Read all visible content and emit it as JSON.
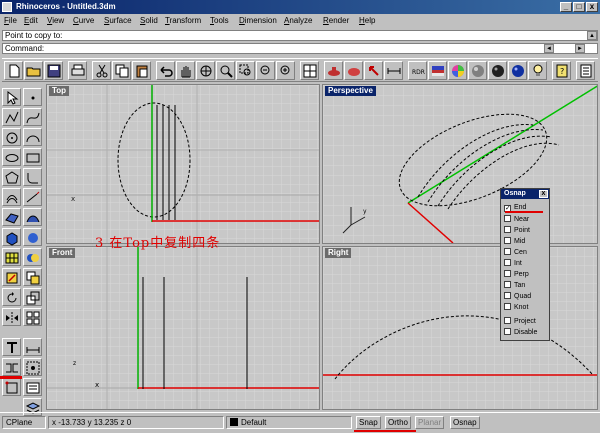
{
  "window": {
    "title": "Rhinoceros - Untitled.3dm",
    "minimize": "_",
    "maximize": "□",
    "close": "x"
  },
  "menu": [
    "File",
    "Edit",
    "View",
    "Curve",
    "Surface",
    "Solid",
    "Transform",
    "Tools",
    "Dimension",
    "Analyze",
    "Render",
    "Help"
  ],
  "history": "Point to copy to:",
  "command": {
    "label": "Command:",
    "value": ""
  },
  "viewports": {
    "top": {
      "label": "Top"
    },
    "perspective": {
      "label": "Perspective"
    },
    "front": {
      "label": "Front"
    },
    "right": {
      "label": "Right"
    }
  },
  "osnap": {
    "title": "Osnap",
    "close": "x",
    "options": [
      {
        "label": "End",
        "checked": true
      },
      {
        "label": "Near",
        "checked": false
      },
      {
        "label": "Point",
        "checked": false
      },
      {
        "label": "Mid",
        "checked": false
      },
      {
        "label": "Cen",
        "checked": false
      },
      {
        "label": "Int",
        "checked": false
      },
      {
        "label": "Perp",
        "checked": false
      },
      {
        "label": "Tan",
        "checked": false
      },
      {
        "label": "Quad",
        "checked": false
      },
      {
        "label": "Knot",
        "checked": false
      },
      {
        "label": "Project",
        "checked": false
      },
      {
        "label": "Disable",
        "checked": false
      }
    ]
  },
  "annotation": "3  在Top中复制四条",
  "status": {
    "cplane": "CPlane",
    "coords": "x -13.733  y 13.235  z 0",
    "layer": "Default",
    "snap": "Snap",
    "ortho": "Ortho",
    "planar": "Planar",
    "osnap": "Osnap"
  },
  "colors": {
    "title_bar": "#0a246a",
    "annotation": "#e00000",
    "x_axis": "#e00000",
    "y_axis": "#00c000"
  }
}
